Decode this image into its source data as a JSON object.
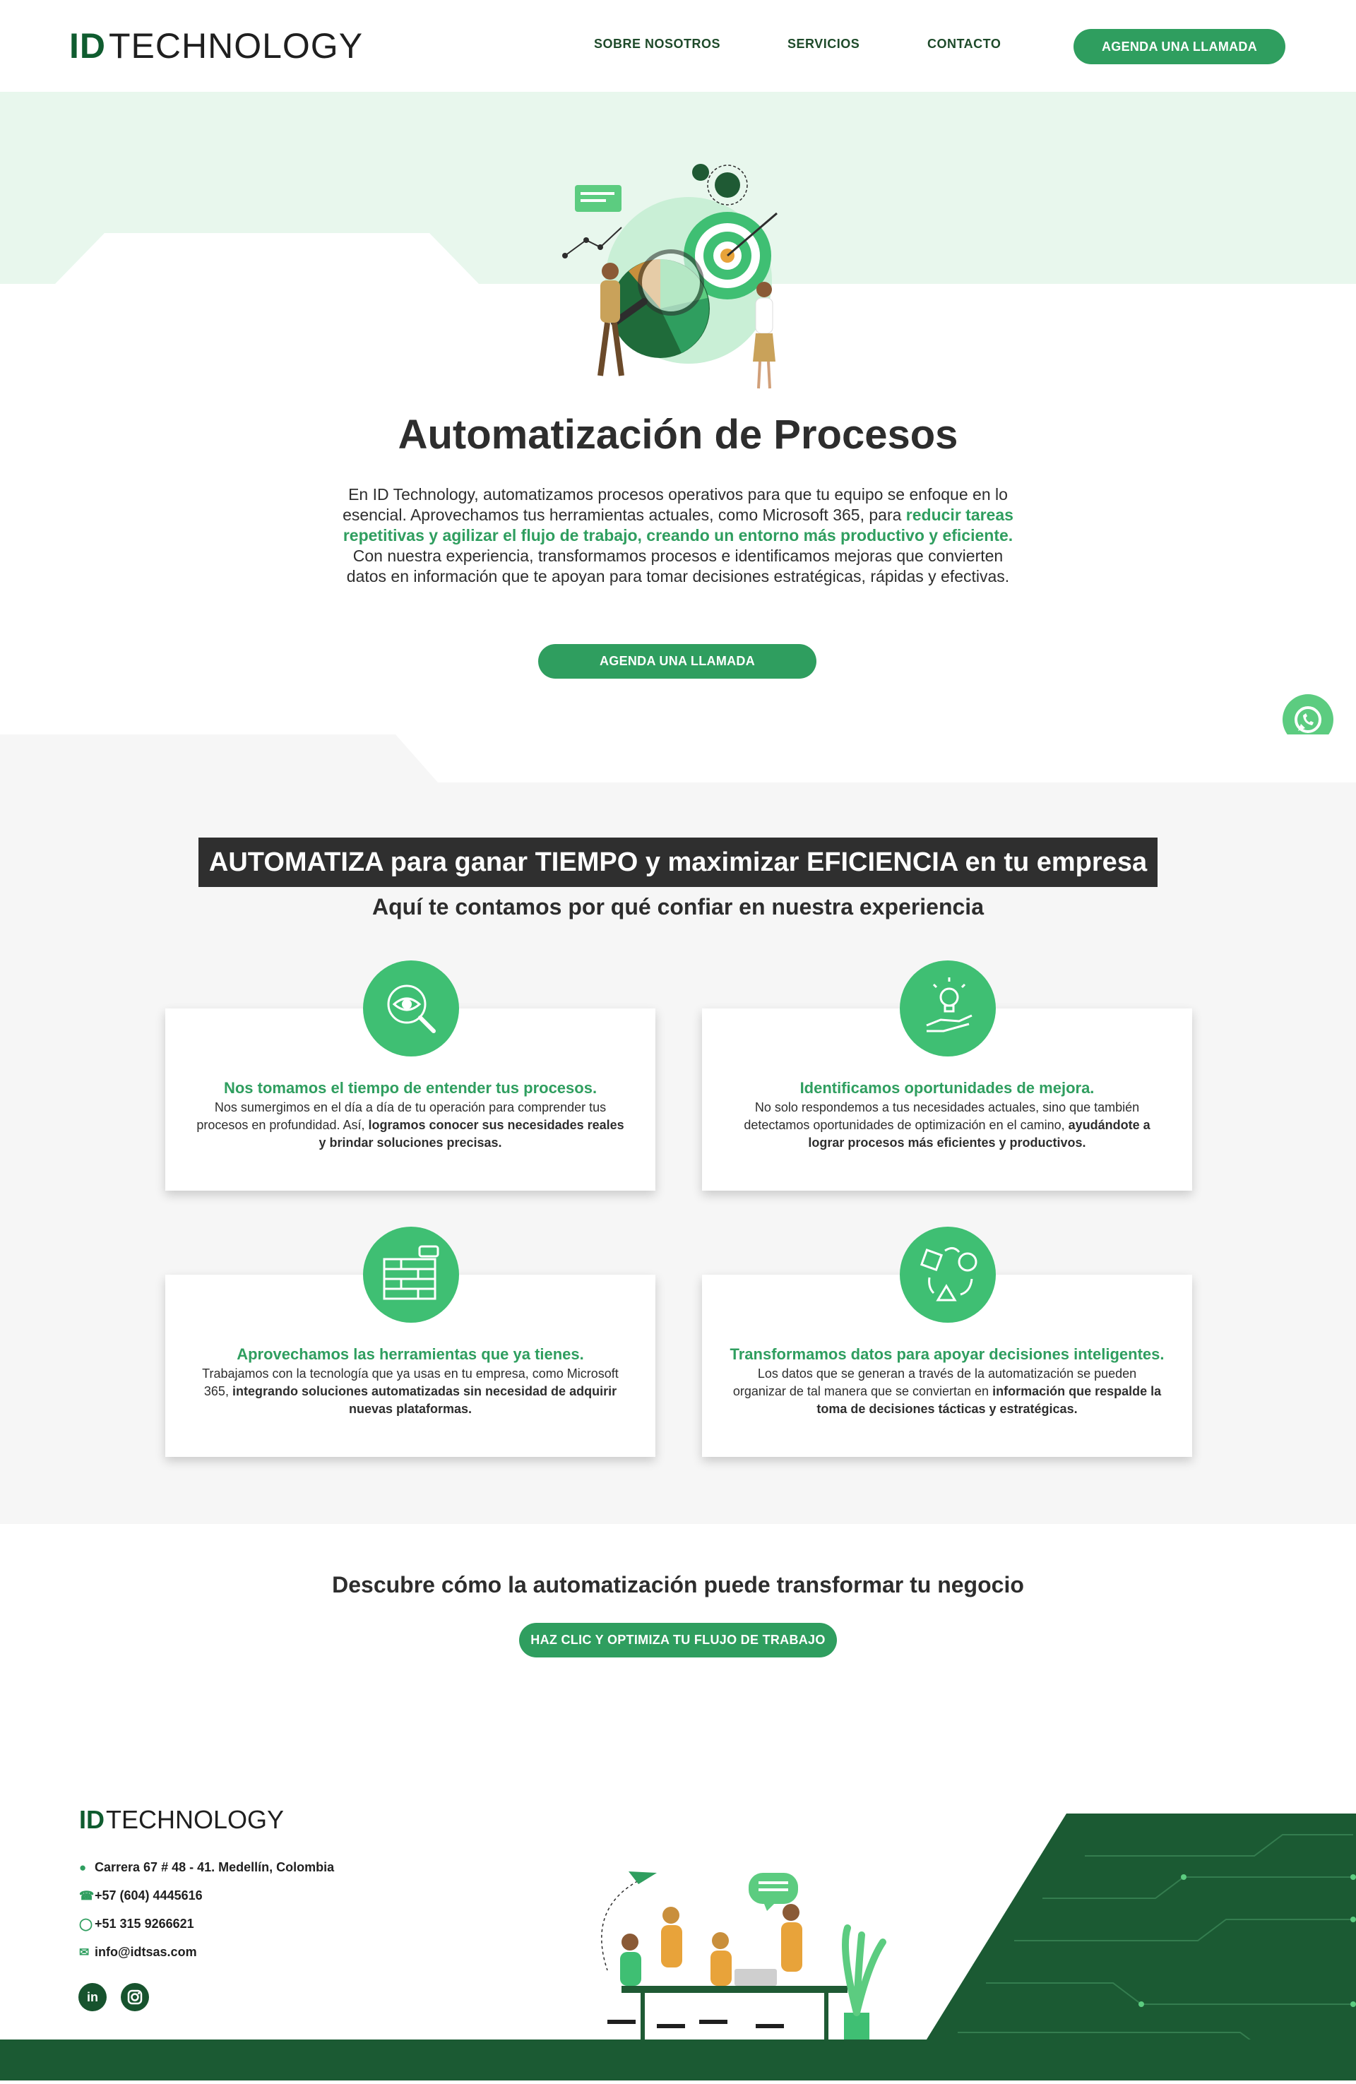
{
  "header": {
    "logo_id": "ID",
    "logo_text": "TECHNOLOGY",
    "nav": [
      "SOBRE NOSOTROS",
      "SERVICIOS",
      "CONTACTO"
    ],
    "cta": "AGENDA UNA LLAMADA"
  },
  "hero": {
    "title": "Automatización de Procesos",
    "text_1": "En ID Technology, automatizamos procesos operativos para que tu equipo se enfoque en lo esencial. Aprovechamos tus herramientas actuales, como Microsoft 365, para ",
    "text_highlight": "reducir tareas repetitivas y agilizar el flujo de trabajo, creando un entorno más productivo y eficiente.",
    "text_2": " Con nuestra experiencia, transformamos procesos e identificamos mejoras que convierten datos en información que te apoyan para tomar decisiones estratégicas, rápidas y efectivas.",
    "cta": "AGENDA UNA LLAMADA"
  },
  "section": {
    "banner": "AUTOMATIZA para ganar TIEMPO y maximizar EFICIENCIA en tu empresa",
    "subtitle": "Aquí te contamos por qué confiar en nuestra experiencia"
  },
  "cards": [
    {
      "title": "Nos tomamos el tiempo de entender tus procesos.",
      "text": "Nos sumergimos en el día a día de tu operación para comprender tus procesos en profundidad. Así, ",
      "bold": "logramos conocer sus necesidades reales y brindar soluciones precisas.",
      "icon": "eye-search-icon"
    },
    {
      "title": "Identificamos oportunidades de mejora.",
      "text": "No solo respondemos a tus necesidades actuales, sino que también detectamos oportunidades de optimización en el camino, ",
      "bold": "ayudándote a lograr procesos más eficientes y productivos.",
      "icon": "lightbulb-hand-icon"
    },
    {
      "title": "Aprovechamos las herramientas que ya tienes.",
      "text": "Trabajamos con la tecnología que ya usas en tu empresa, como Microsoft 365, ",
      "bold": "integrando soluciones automatizadas sin necesidad de adquirir nuevas plataformas.",
      "icon": "bricks-icon"
    },
    {
      "title": "Transformamos datos para apoyar decisiones inteligentes.",
      "text": "Los datos que se generan a través de la automatización se pueden organizar de tal manera que se conviertan en ",
      "bold": "información que respalde la toma de decisiones tácticas y estratégicas.",
      "icon": "shapes-cycle-icon"
    }
  ],
  "cta_section": {
    "title": "Descubre cómo la automatización puede transformar tu negocio",
    "button": "HAZ CLIC Y OPTIMIZA TU FLUJO DE TRABAJO"
  },
  "footer": {
    "logo_id": "ID",
    "logo_text": "TECHNOLOGY",
    "address": "Carrera 67 # 48 - 41. Medellín, Colombia",
    "phone": "+57 (604) 4445616",
    "whatsapp": "+51 315 9266621",
    "email": "info@idtsas.com",
    "social": [
      "in",
      "ig"
    ]
  },
  "colors": {
    "brand_green": "#2f9e5f",
    "dark_green": "#1b5a33",
    "hero_band": "#e8f7ed",
    "gray_bg": "#f6f6f6",
    "banner_bg": "#2f2f2f"
  }
}
